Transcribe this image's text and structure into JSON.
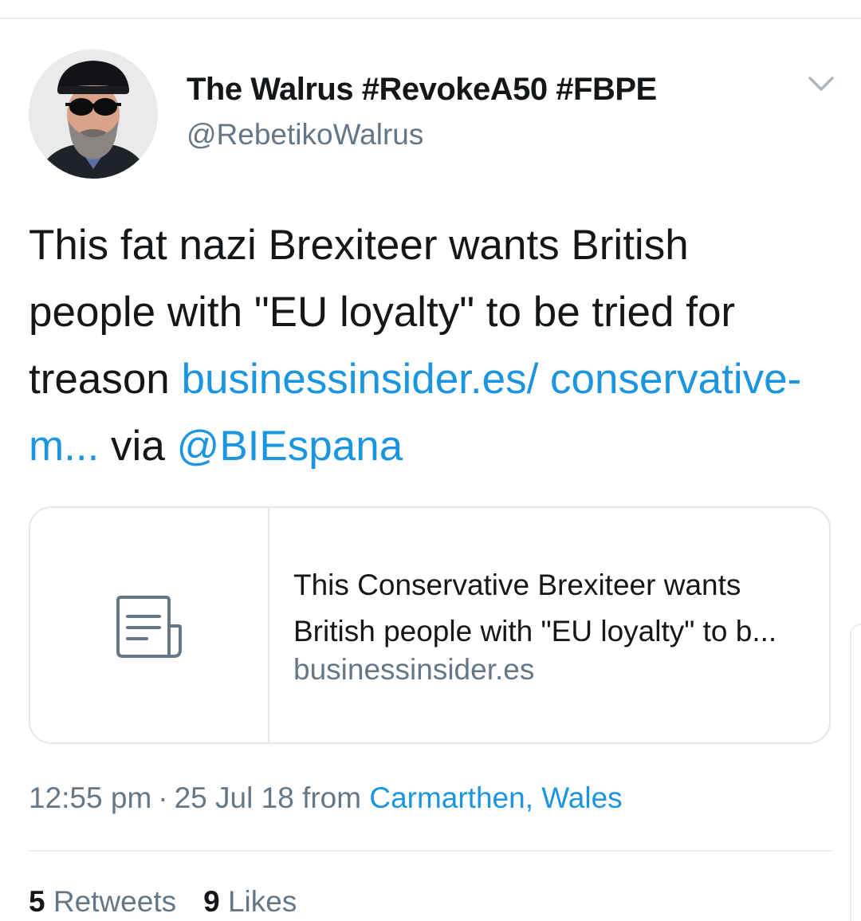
{
  "tweet": {
    "author": {
      "display_name": "The Walrus #RevokeA50 #FBPE",
      "handle": "@RebetikoWalrus",
      "avatar_icon": "user-avatar"
    },
    "menu_icon": "chevron-down-icon",
    "text": {
      "plain1": "This fat nazi Brexiteer wants British people with \"EU loyalty\" to be tried for treason ",
      "link": "businessinsider.es/ conservative-m...",
      "plain2": " via ",
      "mention": "@BIEspana"
    },
    "card": {
      "icon": "article-icon",
      "title_line1": "This Conservative Brexiteer wants",
      "title_line2": "British people with \"EU loyalty\" to b...",
      "domain": "businessinsider.es"
    },
    "meta": {
      "time": "12:55 pm",
      "separator": "·",
      "date": "25 Jul 18",
      "from_label": "from",
      "location": "Carmarthen, Wales"
    },
    "stats": {
      "retweets_count": "5",
      "retweets_label": "Retweets",
      "likes_count": "9",
      "likes_label": "Likes"
    }
  },
  "colors": {
    "link": "#1b95e0",
    "secondary_text": "#657786",
    "primary_text": "#14171a",
    "border": "#e1e8ed"
  }
}
